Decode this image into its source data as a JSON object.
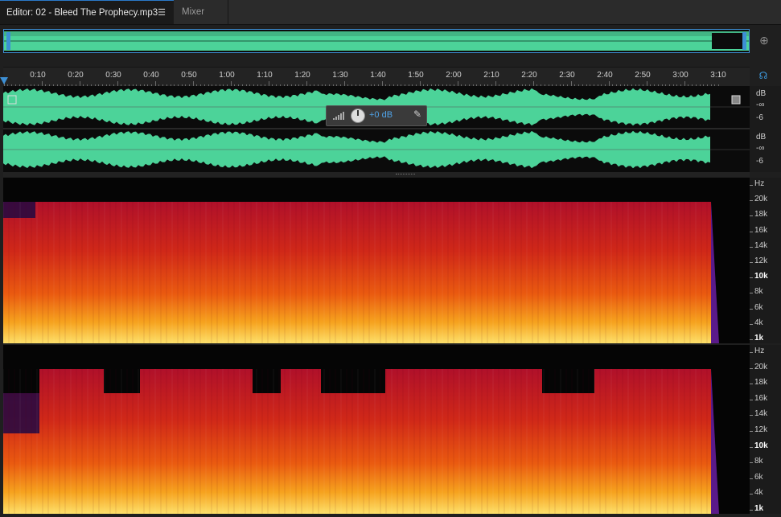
{
  "tabs": {
    "editor_label": "Editor: 02 - Bleed The Prophecy.mp3",
    "menu_icon": "☰",
    "mixer_label": "Mixer"
  },
  "ruler": {
    "unit_label": "hms",
    "ticks": [
      "0:10",
      "0:20",
      "0:30",
      "0:40",
      "0:50",
      "1:00",
      "1:10",
      "1:20",
      "1:30",
      "1:40",
      "1:50",
      "2:00",
      "2:10",
      "2:20",
      "2:30",
      "2:40",
      "2:50",
      "3:00",
      "3:10"
    ]
  },
  "amplitude_scale": {
    "ch1": [
      "dB",
      "-∞",
      "-6"
    ],
    "ch2": [
      "dB",
      "-∞",
      "-6"
    ]
  },
  "hud": {
    "gain_value": "+0 dB"
  },
  "frequency_scale": {
    "labels": [
      "Hz",
      "20k",
      "18k",
      "16k",
      "14k",
      "12k",
      "10k",
      "8k",
      "6k",
      "4k",
      "1k"
    ]
  },
  "colors": {
    "waveform": "#4cd399",
    "accent": "#3d8fd4"
  },
  "icons": {
    "zoom": "zoom-to-fit-icon",
    "headphones": "headphones-icon",
    "pin": "pin-icon",
    "volume": "volume-bars-icon",
    "knob": "gain-knob-icon"
  }
}
